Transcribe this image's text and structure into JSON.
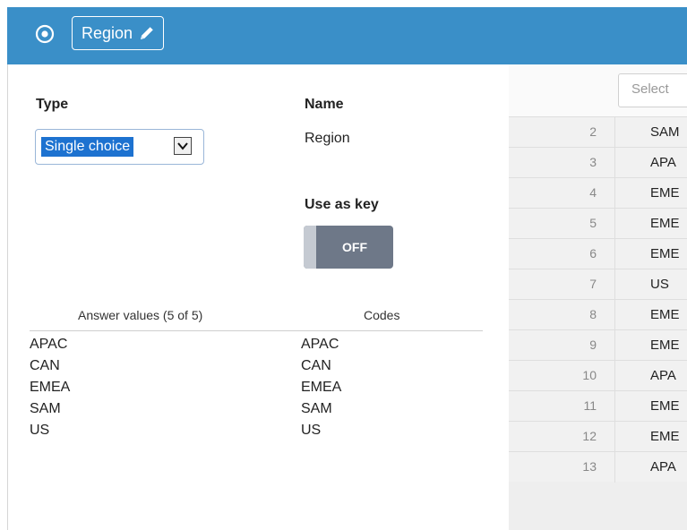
{
  "header": {
    "title": "Region",
    "accent": "#3a8fc8"
  },
  "form": {
    "type_label": "Type",
    "type_value": "Single choice",
    "name_label": "Name",
    "name_value": "Region",
    "use_as_key_label": "Use as key",
    "use_as_key_value": "OFF"
  },
  "answers": {
    "values_header": "Answer values (5 of 5)",
    "codes_header": "Codes",
    "rows": [
      {
        "value": "APAC",
        "code": "APAC"
      },
      {
        "value": "CAN",
        "code": "CAN"
      },
      {
        "value": "EMEA",
        "code": "EMEA"
      },
      {
        "value": "SAM",
        "code": "SAM"
      },
      {
        "value": "US",
        "code": "US"
      }
    ]
  },
  "grid": {
    "filter_placeholder": "Select",
    "rows": [
      {
        "num": "2",
        "val": "SAM"
      },
      {
        "num": "3",
        "val": "APA"
      },
      {
        "num": "4",
        "val": "EME"
      },
      {
        "num": "5",
        "val": "EME"
      },
      {
        "num": "6",
        "val": "EME"
      },
      {
        "num": "7",
        "val": "US"
      },
      {
        "num": "8",
        "val": "EME"
      },
      {
        "num": "9",
        "val": "EME"
      },
      {
        "num": "10",
        "val": "APA"
      },
      {
        "num": "11",
        "val": "EME"
      },
      {
        "num": "12",
        "val": "EME"
      },
      {
        "num": "13",
        "val": "APA"
      }
    ]
  },
  "icons": {
    "header_left": "circle-dot-icon",
    "title_edit": "pencil-icon",
    "select_arrow": "chevron-down-icon"
  }
}
